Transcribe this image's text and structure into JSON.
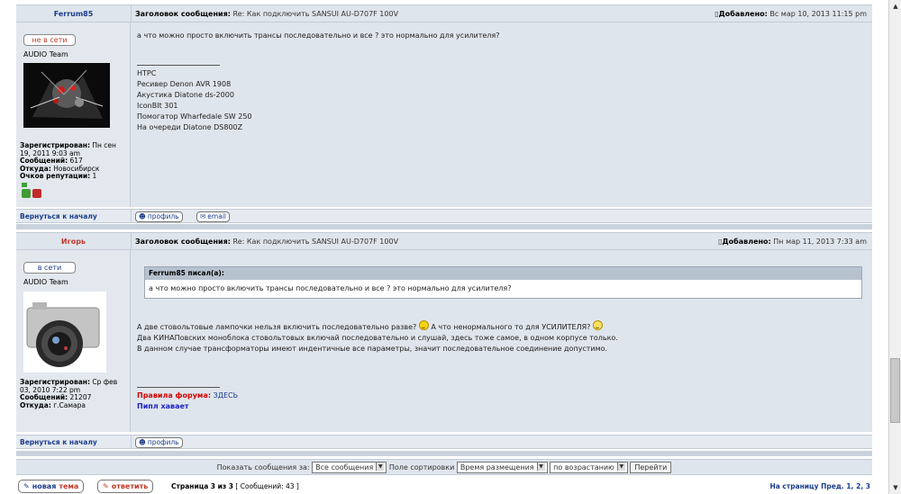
{
  "posts": [
    {
      "author": "Ferrum85",
      "subject_label": "Заголовок сообщения:",
      "subject": "Re: Как подключить SANSUI AU-D707F 100V",
      "posted_label": "Добавлено:",
      "posted": "Вс мар 10, 2013 11:15 pm",
      "status": "не в сети",
      "team": "AUDIO Team",
      "info": {
        "registered_label": "Зарегистрирован:",
        "registered": "Пн сен 19, 2011 9:03 am",
        "messages_label": "Сообщений:",
        "messages": "617",
        "from_label": "Откуда:",
        "from": "Новосибирск",
        "rep_label": "Очков репутации:",
        "rep": "1"
      },
      "message": "а что можно просто включить трансы последовательно и все ? это нормально для усилителя?",
      "signature": [
        "НТРС",
        "Ресивер Denon AVR 1908",
        "Акустика Diatone ds-2000",
        "IconBIt 301",
        "Помогатор Wharfedale SW 250",
        "На очереди Diatone DS800Z"
      ],
      "back": "Вернуться к началу",
      "profile": "профиль",
      "email": "email"
    },
    {
      "author": "Игорь",
      "subject_label": "Заголовок сообщения:",
      "subject": "Re: Как подключить SANSUI AU-D707F 100V",
      "posted_label": "Добавлено:",
      "posted": "Пн мар 11, 2013 7:33 am",
      "status": "в сети",
      "team": "AUDIO Team",
      "info": {
        "registered_label": "Зарегистрирован:",
        "registered": "Ср фев 03, 2010 7:22 pm",
        "messages_label": "Сообщений:",
        "messages": "21207",
        "from_label": "Откуда:",
        "from": "г.Самара"
      },
      "quote_author": "Ferrum85 писал(а):",
      "quote_text": "а что можно просто включить трансы последовательно и все ? это нормально для усилителя?",
      "message_lines": [
        "А две стовольтовые лампочки нельзя включить последовательно разве?",
        "А что ненормального то для УСИЛИТЕЛЯ?",
        "Два КИНАПовских моноблока стовольтовых включай последовательно и слушай, здесь тоже самое, в одном корпусе только.",
        "В данном случае трансформаторы имеют индентичные все параметры, значит последовательное соединение допустимо."
      ],
      "rules_label": "Правила форума:",
      "rules_link": "ЗДЕСЬ",
      "sig2": "Пипл хавает",
      "back": "Вернуться к началу",
      "profile": "профиль"
    }
  ],
  "bottom": {
    "show_label": "Показать сообщения за:",
    "show_value": "Все сообщения",
    "sort_label": "Поле сортировки",
    "sort_value": "Время размещения",
    "order_value": "по возрастанию",
    "go": "Перейти"
  },
  "nav": {
    "new_topic_a": "новая",
    "new_topic_b": "тема",
    "reply": "ответить",
    "page_label": "Страница",
    "page_of": "3 из 3",
    "messages_count": "[ Сообщений: 43 ]",
    "goto_label": "На страницу",
    "prev": "Пред.",
    "pages": [
      "1",
      "2",
      "3"
    ]
  },
  "colors": {
    "author1": "#1a3c8c",
    "author2": "#c0392b",
    "offline": "#c0392b",
    "online": "#1a3c8c",
    "rules": "#d40000",
    "sig2": "#1a22c8"
  }
}
